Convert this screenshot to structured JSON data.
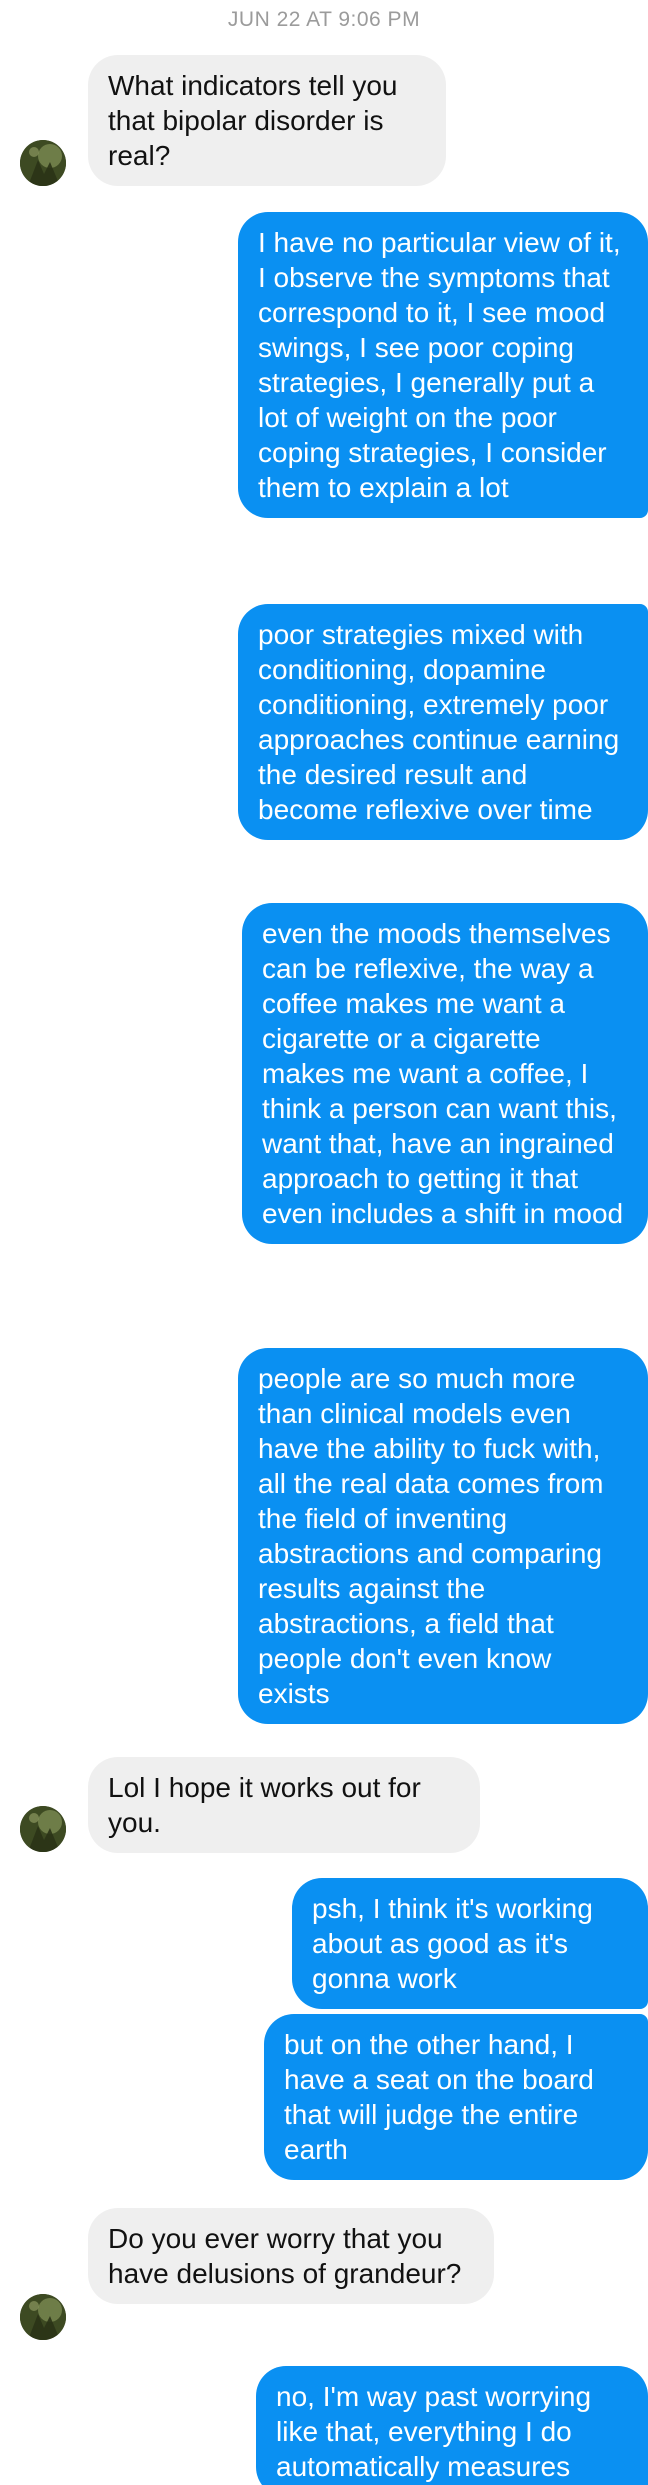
{
  "thread": {
    "timestamp": "JUN 22 AT 9:06 PM",
    "messages": [
      {
        "sender": "them",
        "text": "What indicators tell you that bipolar disorder is real?"
      },
      {
        "sender": "me",
        "text": "I have no particular view of it, I observe the symptoms that correspond to it, I see mood swings, I see poor coping strategies, I generally put a lot of weight on the poor coping strategies, I consider them to explain a lot"
      },
      {
        "sender": "me",
        "text": "poor strategies mixed with conditioning, dopamine conditioning, extremely poor approaches continue earning the desired result and become reflexive over time"
      },
      {
        "sender": "me",
        "text": "even the moods themselves can be reflexive, the way a coffee makes me want a cigarette or a cigarette makes me want a coffee, I think a person can want this, want that, have an ingrained approach to getting it that even includes a shift in mood"
      },
      {
        "sender": "me",
        "text": "people are so much more than clinical models even have the ability to fuck with, all the real data comes from the field of inventing abstractions and comparing results against the abstractions, a field that people don't even know exists"
      },
      {
        "sender": "them",
        "text": "Lol I hope it works out for you."
      },
      {
        "sender": "me",
        "text": "psh, I think it's working about as good as it's gonna work"
      },
      {
        "sender": "me",
        "text": "but on the other hand, I have a seat on the board that will judge the entire earth"
      },
      {
        "sender": "them",
        "text": "Do you ever worry that you have delusions of grandeur?"
      },
      {
        "sender": "me",
        "text": "no, I'm way past worrying like that, everything I do automatically measures"
      }
    ]
  },
  "colors": {
    "outgoing_bubble": "#0a90f2",
    "incoming_bubble": "#efefef",
    "timestamp_text": "#9b9b9b"
  },
  "icons": {
    "avatar": "contact-avatar-photo"
  }
}
